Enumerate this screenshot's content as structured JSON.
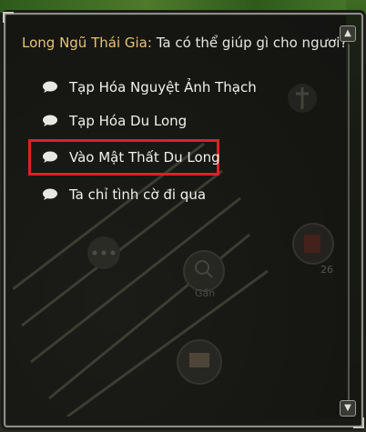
{
  "dialog": {
    "speaker": "Long Ngũ Thái Gia:",
    "question": "Ta có thể giúp gì cho ngươi?",
    "options": [
      {
        "label": "Tạp Hóa Nguyệt Ảnh Thạch",
        "icon": "speech-bubble-icon"
      },
      {
        "label": "Tạp Hóa Du Long",
        "icon": "speech-bubble-icon"
      },
      {
        "label": "Vào Mật Thất Du Long",
        "icon": "speech-bubble-icon",
        "highlighted": true
      },
      {
        "label": "Ta chỉ tình cờ đi qua",
        "icon": "speech-bubble-icon"
      }
    ]
  },
  "scene": {
    "search_label": "Gần",
    "count_label": "26"
  },
  "colors": {
    "speaker": "#e7c27a",
    "text": "#f2f2ec",
    "highlight": "#e21f26"
  }
}
